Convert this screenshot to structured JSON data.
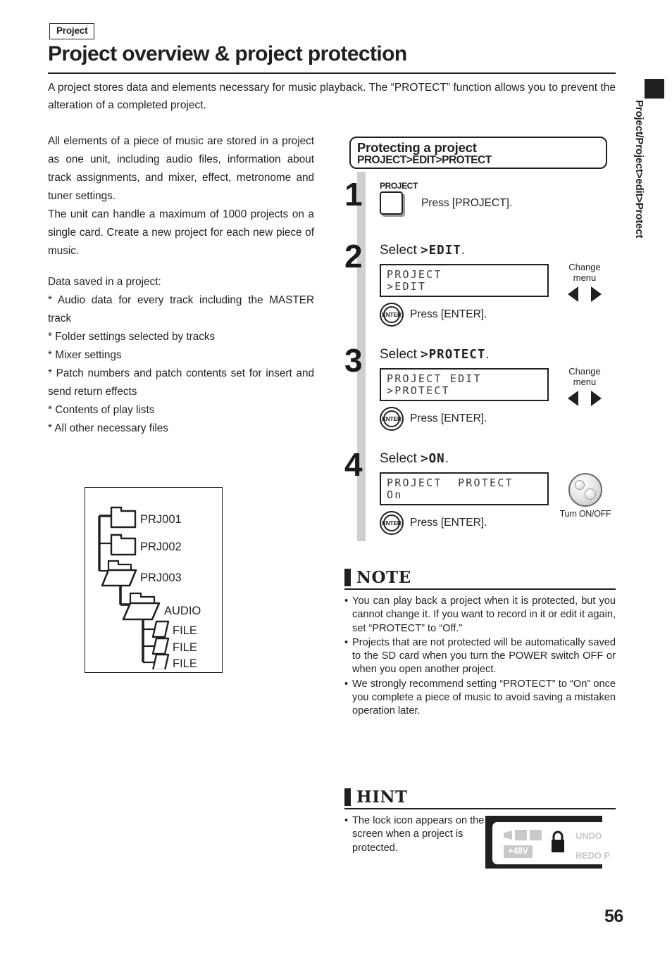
{
  "header": {
    "tag": "Project",
    "title": "Project overview & project protection",
    "intro": "A project stores data and elements necessary for music playback. The “PROTECT” function allows you to prevent the alteration of a completed project."
  },
  "margin": {
    "tab_text": "Project/Project>edit>Protect"
  },
  "left_column": {
    "para1": "All elements of a piece of music are stored in a project as one unit, including audio files, information about track assignments, and mixer, effect, metronome and tuner settings.",
    "para2": "The unit can handle a maximum of 1000 projects on a single card. Create a new project for each new piece of music.",
    "data_saved_heading": "Data saved in a project:",
    "bullets": [
      " * Audio data for every track including the MASTER track",
      " * Folder settings selected by tracks",
      " * Mixer settings",
      " * Patch numbers and patch contents set for insert and send return effects",
      " * Contents of play lists",
      " * All other necessary files"
    ]
  },
  "tree": {
    "nodes": [
      {
        "label": "PRJ001",
        "type": "folder-closed"
      },
      {
        "label": "PRJ002",
        "type": "folder-closed"
      },
      {
        "label": "PRJ003",
        "type": "folder-open"
      },
      {
        "label": "AUDIO",
        "type": "folder-open"
      },
      {
        "label": "FILE",
        "type": "file"
      },
      {
        "label": "FILE",
        "type": "file"
      },
      {
        "label": "FILE",
        "type": "file"
      }
    ]
  },
  "procedure": {
    "title": "Protecting a project",
    "path": "PROJECT>EDIT>PROTECT",
    "steps": [
      {
        "number": "1",
        "button_label": "PROJECT",
        "instruction": "Press [PROJECT]."
      },
      {
        "number": "2",
        "select_prefix": "Select ",
        "select_value": ">EDIT",
        "select_suffix": ".",
        "lcd_line1": "PROJECT",
        "lcd_line2": ">EDIT",
        "enter_label": "ENTER",
        "enter_instruction": "Press [ENTER].",
        "side_caption_line1": "Change",
        "side_caption_line2": "menu"
      },
      {
        "number": "3",
        "select_prefix": "Select ",
        "select_value": ">PROTECT",
        "select_suffix": ".",
        "lcd_line1": "PROJECT EDIT",
        "lcd_line2": ">PROTECT",
        "enter_label": "ENTER",
        "enter_instruction": "Press [ENTER].",
        "side_caption_line1": "Change",
        "side_caption_line2": "menu"
      },
      {
        "number": "4",
        "select_prefix": "Select ",
        "select_value": ">ON",
        "select_suffix": ".",
        "lcd_line1": "PROJECT  PROTECT",
        "lcd_line2": "On",
        "enter_label": "ENTER",
        "enter_instruction": "Press [ENTER].",
        "dial_caption": "Turn ON/OFF"
      }
    ]
  },
  "note": {
    "title": "NOTE",
    "items": [
      "You can play back a project when it is protected, but you cannot change it. If you want to record in it or edit it again, set “PROTECT” to “Off.”",
      "Projects that are not protected will be automatically saved to the SD card when you turn the POWER switch OFF or when you open another project.",
      "We strongly recommend setting “PROTECT” to “On” once you complete a piece of music to avoid saving a mistaken operation later."
    ]
  },
  "hint": {
    "title": "HINT",
    "item": "The lock icon appears on the screen when a project is protected.",
    "lcd_shot": {
      "phantom_label": "+48V",
      "undo_label": "UNDO",
      "redo_label": "REDO  P"
    }
  },
  "footer": {
    "page_number": "56"
  },
  "colors": {
    "ink": "#231f20",
    "rail_gray": "#cfcfcf",
    "lcd_gray": "#c9c9c9"
  }
}
